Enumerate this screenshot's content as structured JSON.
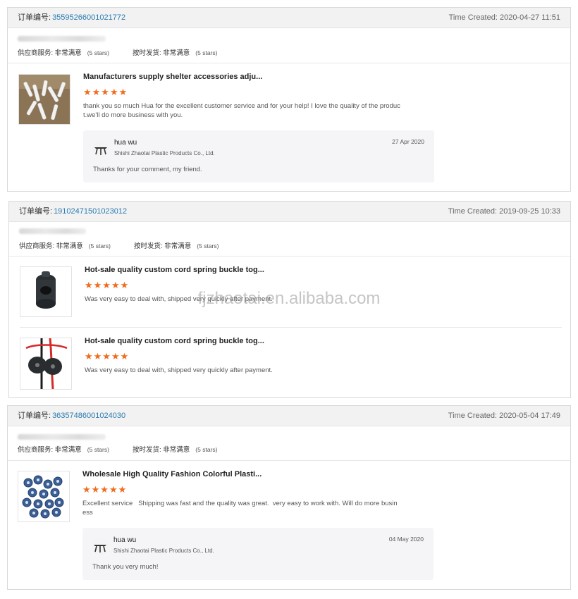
{
  "watermark": "fjzhaotai.en.alibaba.com",
  "labels": {
    "order_no": "订单编号:",
    "supplier_service": "供应商服务:",
    "on_time_delivery": "按时发货:",
    "very_satisfied": "非常满意",
    "five_stars": "(5 stars)",
    "stars_glyphs": "★★★★★"
  },
  "reviews": [
    {
      "order_no": "35595266001021772",
      "time_created": "Time Created: 2020-04-27 11:51",
      "items": [
        {
          "title": "Manufacturers supply shelter accessories adju...",
          "rating": 5,
          "comment_line1": "thank you so much Hua for the excellent customer service and for your help! I love the quality of the produc",
          "comment_line2": "t.we'll do more business with you."
        }
      ],
      "reply": {
        "name": "hua wu",
        "company": "Shishi Zhaotai Plastic Products Co., Ltd.",
        "date": "27 Apr 2020",
        "text": "Thanks for your comment, my friend."
      }
    },
    {
      "order_no": "19102471501023012",
      "time_created": "Time Created: 2019-09-25 10:33",
      "items": [
        {
          "title": "Hot-sale quality custom cord spring buckle tog...",
          "rating": 5,
          "comment_line1": "Was very easy to deal with, shipped very quickly after payment."
        },
        {
          "title": "Hot-sale quality custom cord spring buckle tog...",
          "rating": 5,
          "comment_line1": "Was very easy to deal with, shipped very quickly after payment."
        }
      ]
    },
    {
      "order_no": "36357486001024030",
      "time_created": "Time Created: 2020-05-04 17:49",
      "items": [
        {
          "title": "Wholesale High Quality Fashion Colorful Plasti...",
          "rating": 5,
          "comment_line1": "Excellent service   Shipping was fast and the quality was great.  very easy to work with. Will do more busin",
          "comment_line2": "ess"
        }
      ],
      "reply": {
        "name": "hua wu",
        "company": "Shishi Zhaotai Plastic Products Co., Ltd.",
        "date": "04 May 2020",
        "text": "Thank you very much!"
      }
    }
  ]
}
